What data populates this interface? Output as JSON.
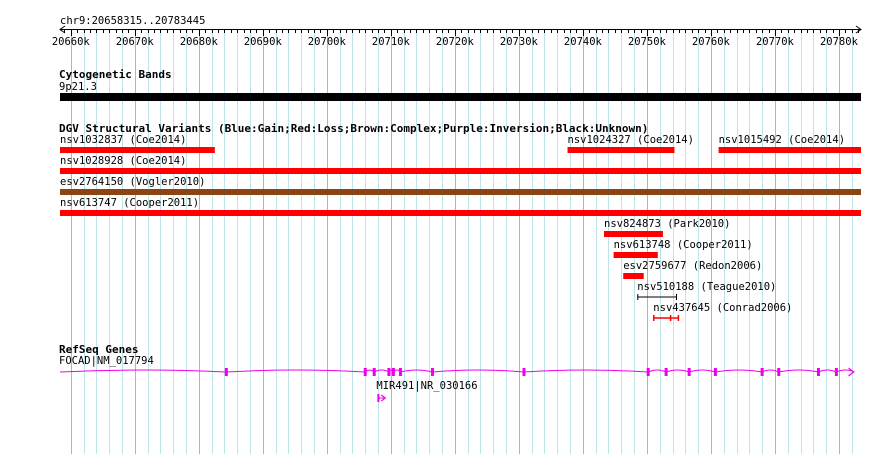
{
  "location": "chr9:20658315..20783445",
  "view": {
    "start": 20658315,
    "end": 20783445,
    "grid_step_bp": 2000
  },
  "ruler": {
    "labels": [
      "20660k",
      "20670k",
      "20680k",
      "20690k",
      "20700k",
      "20710k",
      "20720k",
      "20730k",
      "20740k",
      "20750k",
      "20760k",
      "20770k",
      "20780k"
    ],
    "positions": [
      20660000,
      20670000,
      20680000,
      20690000,
      20700000,
      20710000,
      20720000,
      20730000,
      20740000,
      20750000,
      20760000,
      20770000,
      20780000
    ]
  },
  "cytobands": {
    "title": "Cytogenetic Bands",
    "band": {
      "name": "9p21.3",
      "start": 20658315,
      "end": 20783445,
      "color": "#000000"
    }
  },
  "dgv": {
    "title": "DGV Structural Variants (Blue:Gain;Red:Loss;Brown:Complex;Purple:Inversion;Black:Unknown)",
    "features": [
      {
        "name": "nsv1032837 (Coe2014)",
        "start": 20658315,
        "end": 20682500,
        "row": 0,
        "style": "bar",
        "color": "#ff0000"
      },
      {
        "name": "nsv1024327 (Coe2014)",
        "start": 20737600,
        "end": 20754300,
        "row": 0,
        "style": "bar",
        "color": "#ff0000"
      },
      {
        "name": "nsv1015492 (Coe2014)",
        "start": 20761200,
        "end": 20783445,
        "row": 0,
        "style": "bar",
        "color": "#ff0000"
      },
      {
        "name": "nsv1028928 (Coe2014)",
        "start": 20658315,
        "end": 20783445,
        "row": 1,
        "style": "bar",
        "color": "#ff0000"
      },
      {
        "name": "esv2764150 (Vogler2010)",
        "start": 20658315,
        "end": 20783445,
        "row": 2,
        "style": "bar",
        "color": "#8b4513"
      },
      {
        "name": "nsv613747 (Cooper2011)",
        "start": 20658315,
        "end": 20783445,
        "row": 3,
        "style": "bar",
        "color": "#ff0000"
      },
      {
        "name": "nsv824873 (Park2010)",
        "start": 20743300,
        "end": 20752500,
        "row": 4,
        "style": "bar",
        "color": "#ff0000"
      },
      {
        "name": "nsv613748 (Cooper2011)",
        "start": 20744800,
        "end": 20751700,
        "row": 5,
        "style": "bar",
        "color": "#ff0000"
      },
      {
        "name": "esv2759677 (Redon2006)",
        "start": 20746300,
        "end": 20749500,
        "row": 6,
        "style": "bar",
        "color": "#ff0000"
      },
      {
        "name": "nsv510188 (Teague2010)",
        "start": 20748500,
        "end": 20754700,
        "row": 7,
        "style": "span",
        "color": "#000000"
      },
      {
        "name": "nsv437645 (Conrad2006)",
        "start": 20751000,
        "end": 20755000,
        "row": 8,
        "style": "dumbbell",
        "color": "#ff0000"
      }
    ]
  },
  "refseq": {
    "title": "RefSeq Genes",
    "color": "#ee00ee",
    "genes": [
      {
        "name": "FOCAD|NM_017794",
        "start": 20658315,
        "end": 20783445,
        "exons": [
          20684300,
          20706000,
          20707400,
          20709700,
          20710400,
          20711500,
          20716500,
          20730800,
          20750200,
          20753000,
          20756600,
          20760700,
          20768000,
          20770600,
          20776800,
          20779600
        ],
        "arrow_at": 20781500
      },
      {
        "name": "MIR491|NR_030166",
        "start": 20707900,
        "end": 20708600,
        "exons": [],
        "arrow_at": 20708500
      }
    ]
  }
}
